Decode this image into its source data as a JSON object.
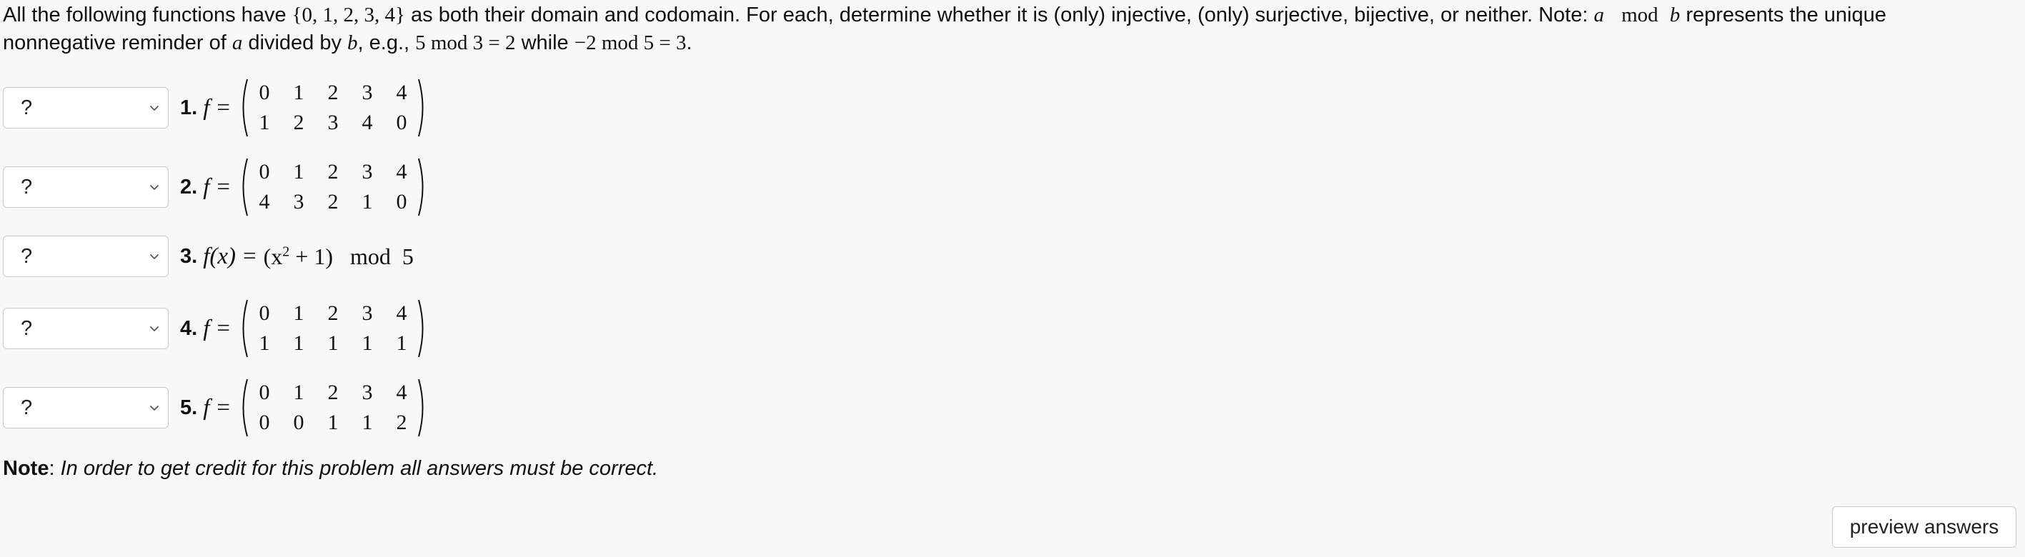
{
  "intro": {
    "t1": "All the following functions have ",
    "set": "{0, 1, 2, 3, 4}",
    "t2": " as both their domain and codomain. For each, determine whether it is (only) injective, (only) surjective, bijective, or neither. Note: ",
    "a": "a",
    "mod": "mod",
    "b": "b",
    "t3": " represents the unique nonnegative reminder of ",
    "a2": "a",
    "t4": " divided by ",
    "b2": "b",
    "t5": ", e.g., ",
    "ex1": "5  mod  3 = 2",
    "t6": " while ",
    "ex2": "−2  mod  5 = 3",
    "t7": "."
  },
  "questions": [
    {
      "number": "1.",
      "selected": "?",
      "f": "f",
      "eq": "=",
      "top": [
        "0",
        "1",
        "2",
        "3",
        "4"
      ],
      "bottom": [
        "1",
        "2",
        "3",
        "4",
        "0"
      ]
    },
    {
      "number": "2.",
      "selected": "?",
      "f": "f",
      "eq": "=",
      "top": [
        "0",
        "1",
        "2",
        "3",
        "4"
      ],
      "bottom": [
        "4",
        "3",
        "2",
        "1",
        "0"
      ]
    },
    {
      "number": "3.",
      "selected": "?",
      "fx": "f(x)",
      "eq": "=",
      "expr_a": "(x",
      "expr_sup": "2",
      "expr_b": " + 1)",
      "expr_mod": "mod",
      "expr_n": "5"
    },
    {
      "number": "4.",
      "selected": "?",
      "f": "f",
      "eq": "=",
      "top": [
        "0",
        "1",
        "2",
        "3",
        "4"
      ],
      "bottom": [
        "1",
        "1",
        "1",
        "1",
        "1"
      ]
    },
    {
      "number": "5.",
      "selected": "?",
      "f": "f",
      "eq": "=",
      "top": [
        "0",
        "1",
        "2",
        "3",
        "4"
      ],
      "bottom": [
        "0",
        "0",
        "1",
        "1",
        "2"
      ]
    }
  ],
  "note": {
    "label": "Note",
    "colon": ": ",
    "text": "In order to get credit for this problem all answers must be correct."
  },
  "preview_button": "preview answers",
  "icons": {
    "dropdown": "chevron-down-icon"
  }
}
